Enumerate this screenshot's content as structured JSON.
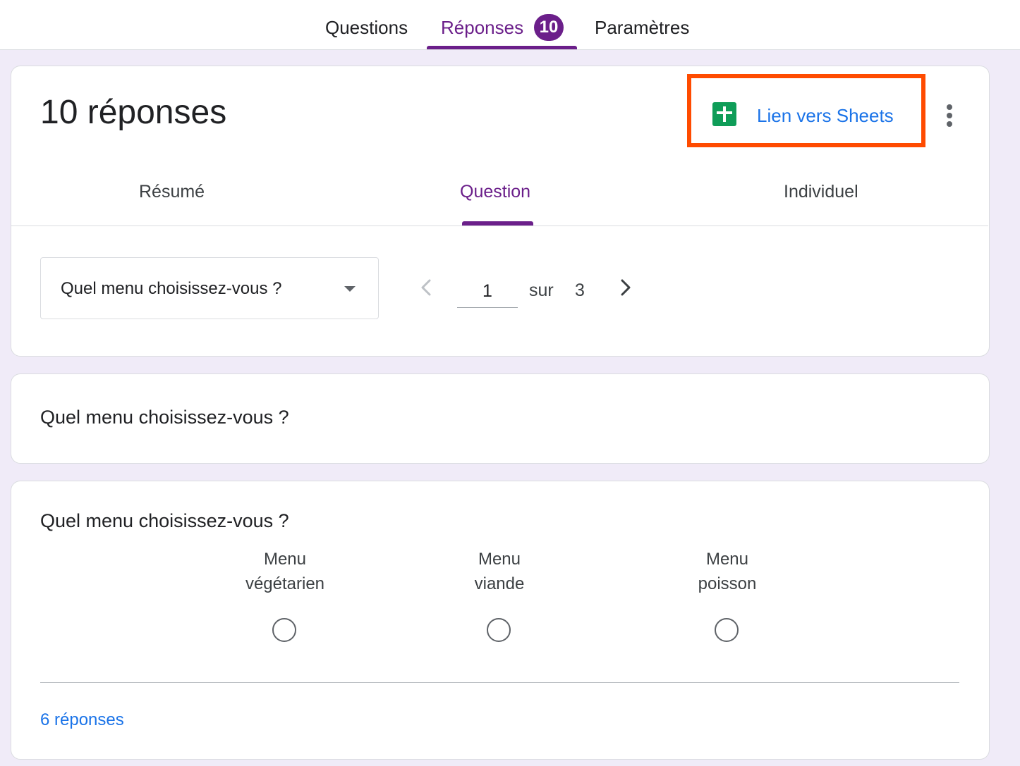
{
  "top_tabs": {
    "questions": "Questions",
    "responses": "Réponses",
    "responses_badge": "10",
    "settings": "Paramètres"
  },
  "header": {
    "title": "10 réponses",
    "sheets_link_label": "Lien vers Sheets",
    "sheets_icon": "google-sheets-icon",
    "more_icon": "more-vert-icon",
    "highlight_color": "#ff4b00"
  },
  "sub_tabs": {
    "summary": "Résumé",
    "question": "Question",
    "individual": "Individuel",
    "active": "Question"
  },
  "question_selector": {
    "selected": "Quel menu choisissez-vous ?"
  },
  "pager": {
    "current": "1",
    "of_label": "sur",
    "total": "3"
  },
  "question_title_card": {
    "title": "Quel menu choisissez-vous ?"
  },
  "question_detail": {
    "title": "Quel menu choisissez-vous ?",
    "options": [
      {
        "line1": "Menu",
        "line2": "végétarien"
      },
      {
        "line1": "Menu",
        "line2": "viande"
      },
      {
        "line1": "Menu",
        "line2": "poisson"
      }
    ],
    "response_count": "6 réponses"
  },
  "colors": {
    "accent_purple": "#6b1f8a",
    "link_blue": "#1a73e8",
    "background": "#f0ebf8",
    "sheets_green": "#0f9d58"
  }
}
